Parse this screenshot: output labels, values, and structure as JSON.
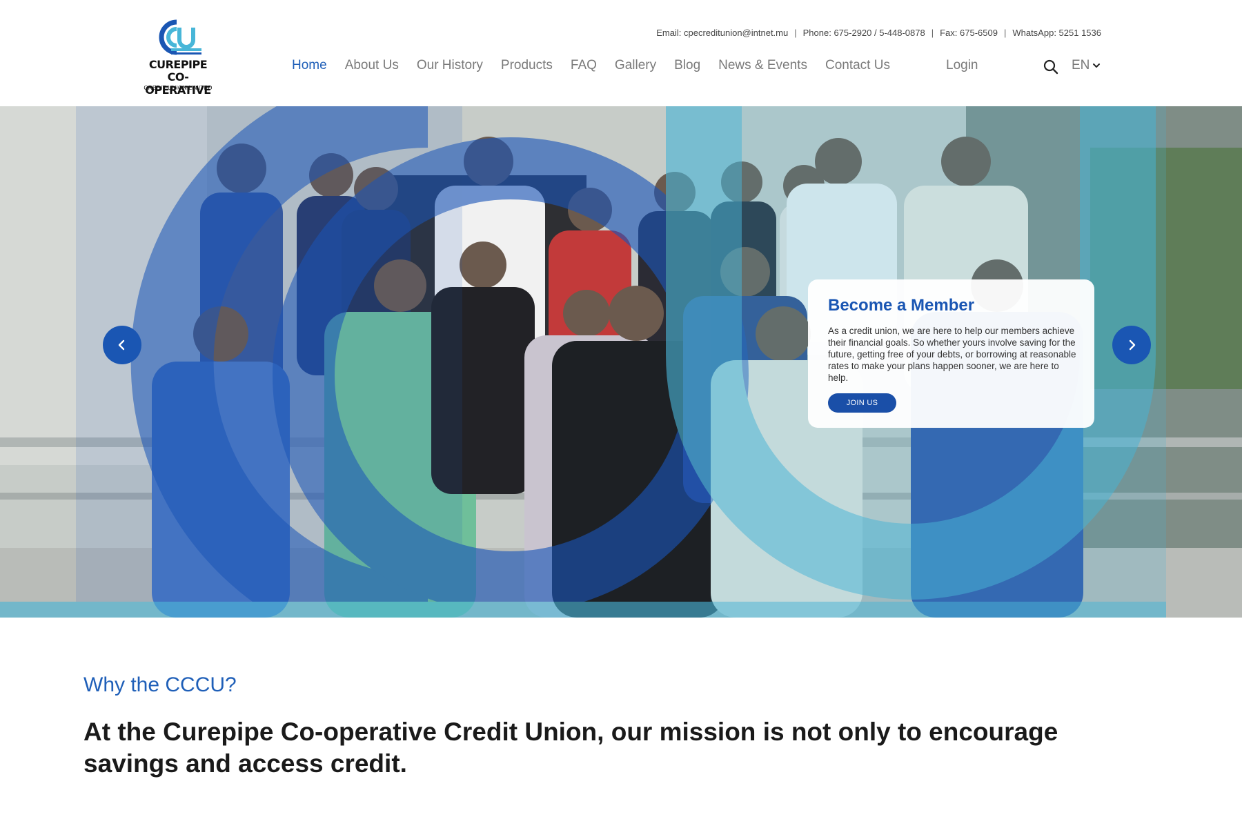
{
  "brand": {
    "line1": "CUREPIPE",
    "line2": "CO-OPERATIVE",
    "line3": "CREDIT UNION LIMITED",
    "primary_color": "#1a56b3",
    "accent_color": "#48b6d8"
  },
  "contact": {
    "email": "Email: cpecreditunion@intnet.mu",
    "phone": "Phone: 675-2920 / 5-448-0878",
    "fax": "Fax: 675-6509",
    "whatsapp": "WhatsApp: 5251 1536",
    "separator": "|"
  },
  "nav": {
    "items": [
      {
        "label": "Home",
        "active": true
      },
      {
        "label": "About Us",
        "active": false
      },
      {
        "label": "Our History",
        "active": false
      },
      {
        "label": "Products",
        "active": false
      },
      {
        "label": "FAQ",
        "active": false
      },
      {
        "label": "Gallery",
        "active": false
      },
      {
        "label": "Blog",
        "active": false
      },
      {
        "label": "News & Events",
        "active": false
      },
      {
        "label": "Contact Us",
        "active": false
      }
    ],
    "login": "Login",
    "language": "EN",
    "search_icon": "search-icon",
    "language_icon": "chevron-down-icon"
  },
  "hero": {
    "card": {
      "title": "Become a Member",
      "text": "As a credit union, we are here to help our members achieve their financial goals. So whether yours involve saving for the future, getting free of your debts, or borrowing at reasonable rates to make your plans happen sooner, we are here to help.",
      "button": "JOIN US"
    },
    "prev_icon": "chevron-left-icon",
    "next_icon": "chevron-right-icon"
  },
  "why": {
    "label": "Why the CCCU?",
    "mission": "At the Curepipe Co-operative Credit Union, our mission is not only to encourage savings and access credit."
  }
}
